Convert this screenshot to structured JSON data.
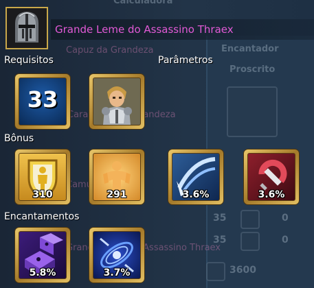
{
  "background": {
    "labels": [
      "Calculadora",
      "Capuz da Grandeza",
      "Encantador",
      "Proscrito",
      "Caracteres da Grandeza",
      "Camuflagem",
      "Grande Leme do Assassino Thraex"
    ],
    "numbers": [
      "35",
      "0",
      "35",
      "0",
      "3600"
    ]
  },
  "item": {
    "name": "Grande Leme do Assassino Thraex",
    "icon": "helmet-icon"
  },
  "sections": {
    "requirements": "Requisitos",
    "parameters": "Parâmetros",
    "bonus": "Bônus",
    "enchantments": "Encantamentos"
  },
  "requirements": {
    "level": "33",
    "class_icon": "armored-knight-portrait-icon"
  },
  "bonus": [
    {
      "icon": "shield-stamina-icon",
      "value": "310"
    },
    {
      "icon": "body-strength-icon",
      "value": "291"
    },
    {
      "icon": "critical-strike-icon",
      "value": "3.6%"
    },
    {
      "icon": "magnet-sword-icon",
      "value": "3.6%"
    }
  ],
  "enchantments": [
    {
      "icon": "purple-dice-icon",
      "value": "5.8%"
    },
    {
      "icon": "blue-vortex-icon",
      "value": "3.7%"
    }
  ],
  "colors": {
    "item_name": "#e25ad6",
    "slot_frame": "#c9a84a",
    "level_bg": "#0d3a72"
  }
}
